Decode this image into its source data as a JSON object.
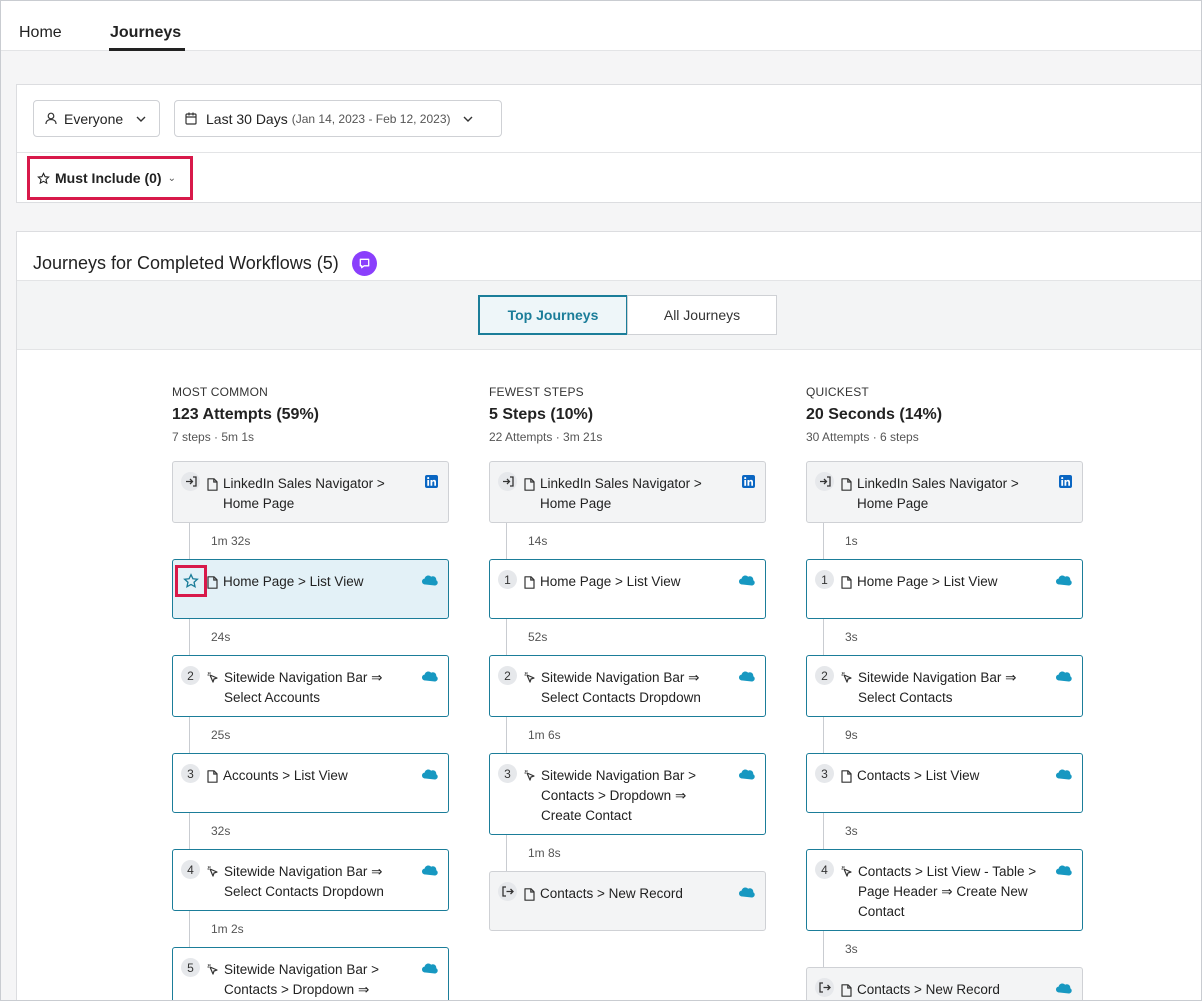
{
  "nav": {
    "tabs": [
      "Home",
      "Journeys"
    ]
  },
  "filters": {
    "audience": "Everyone",
    "date_label": "Last 30 Days",
    "date_range": "(Jan 14, 2023 - Feb 12, 2023)",
    "must_include": "Must Include (0)"
  },
  "panel": {
    "title": "Journeys for Completed Workflows (5)",
    "toggle": [
      "Top Journeys",
      "All Journeys"
    ]
  },
  "columns": [
    {
      "kicker": "MOST COMMON",
      "headline": "123 Attempts (59%)",
      "meta": "7 steps · 5m 1s",
      "durations": [
        "1m 32s",
        "24s",
        "25s",
        "32s",
        "1m 2s"
      ],
      "steps": [
        {
          "marker": "start",
          "lines": [
            "LinkedIn Sales Navigator >",
            "Home Page"
          ]
        },
        {
          "marker": "star",
          "lines": [
            "Home Page > List View"
          ]
        },
        {
          "marker": "2",
          "lines": [
            "Sitewide Navigation Bar ⇒",
            "Select Accounts"
          ]
        },
        {
          "marker": "3",
          "lines": [
            "Accounts > List View"
          ]
        },
        {
          "marker": "4",
          "lines": [
            "Sitewide Navigation Bar ⇒",
            "Select Contacts Dropdown"
          ]
        },
        {
          "marker": "5",
          "lines": [
            "Sitewide Navigation Bar >",
            "Contacts > Dropdown ⇒"
          ]
        }
      ]
    },
    {
      "kicker": "FEWEST STEPS",
      "headline": "5 Steps (10%)",
      "meta": "22 Attempts · 3m 21s",
      "durations": [
        "14s",
        "52s",
        "1m 6s",
        "1m 8s"
      ],
      "steps": [
        {
          "marker": "start",
          "lines": [
            "LinkedIn Sales Navigator >",
            "Home Page"
          ]
        },
        {
          "marker": "1",
          "lines": [
            "Home Page > List View"
          ]
        },
        {
          "marker": "2",
          "lines": [
            "Sitewide Navigation Bar ⇒",
            "Select Contacts Dropdown"
          ]
        },
        {
          "marker": "3",
          "lines": [
            "Sitewide Navigation Bar >",
            "Contacts > Dropdown ⇒",
            "Create Contact"
          ]
        },
        {
          "marker": "end",
          "lines": [
            "Contacts > New Record"
          ]
        }
      ]
    },
    {
      "kicker": "QUICKEST",
      "headline": "20 Seconds (14%)",
      "meta": "30 Attempts · 6 steps",
      "durations": [
        "1s",
        "3s",
        "9s",
        "3s",
        "3s"
      ],
      "steps": [
        {
          "marker": "start",
          "lines": [
            "LinkedIn Sales Navigator >",
            "Home Page"
          ]
        },
        {
          "marker": "1",
          "lines": [
            "Home Page > List View"
          ]
        },
        {
          "marker": "2",
          "lines": [
            "Sitewide Navigation Bar ⇒",
            "Select Contacts"
          ]
        },
        {
          "marker": "3",
          "lines": [
            "Contacts > List View"
          ]
        },
        {
          "marker": "4",
          "lines": [
            "Contacts > List View - Table >",
            "Page Header ⇒ Create New",
            "Contact"
          ]
        },
        {
          "marker": "end",
          "lines": [
            "Contacts > New Record"
          ]
        }
      ]
    }
  ]
}
